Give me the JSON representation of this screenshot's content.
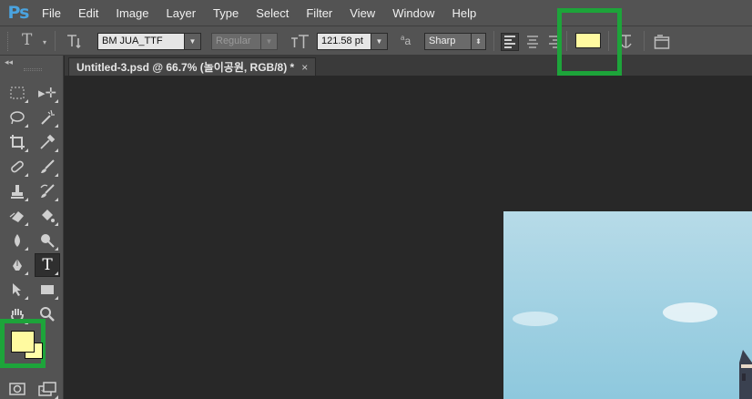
{
  "app": {
    "logo": "Ps"
  },
  "menu": [
    "File",
    "Edit",
    "Image",
    "Layer",
    "Type",
    "Select",
    "Filter",
    "View",
    "Window",
    "Help"
  ],
  "options_bar": {
    "tool_icon": "type-tool-icon",
    "orientation_icon": "text-orientation-icon",
    "font_family": "BM JUA_TTF",
    "font_style": "Regular",
    "font_size_icon": "font-size-icon",
    "font_size": "121.58 pt",
    "antialias_icon": "antialias-icon",
    "antialias": "Sharp",
    "text_color": "#fffaa0",
    "warp_icon": "warp-text-icon",
    "panels_icon": "character-panel-icon"
  },
  "document": {
    "tab_title": "Untitled-3.psd @ 66.7% (놀이공원, RGB/8) *",
    "close_label": "×"
  },
  "tools": {
    "collapse_label": "◂◂",
    "foreground_color": "#fffaa0",
    "background_color": "#ffffa8"
  },
  "highlight_color": "#1da43a"
}
